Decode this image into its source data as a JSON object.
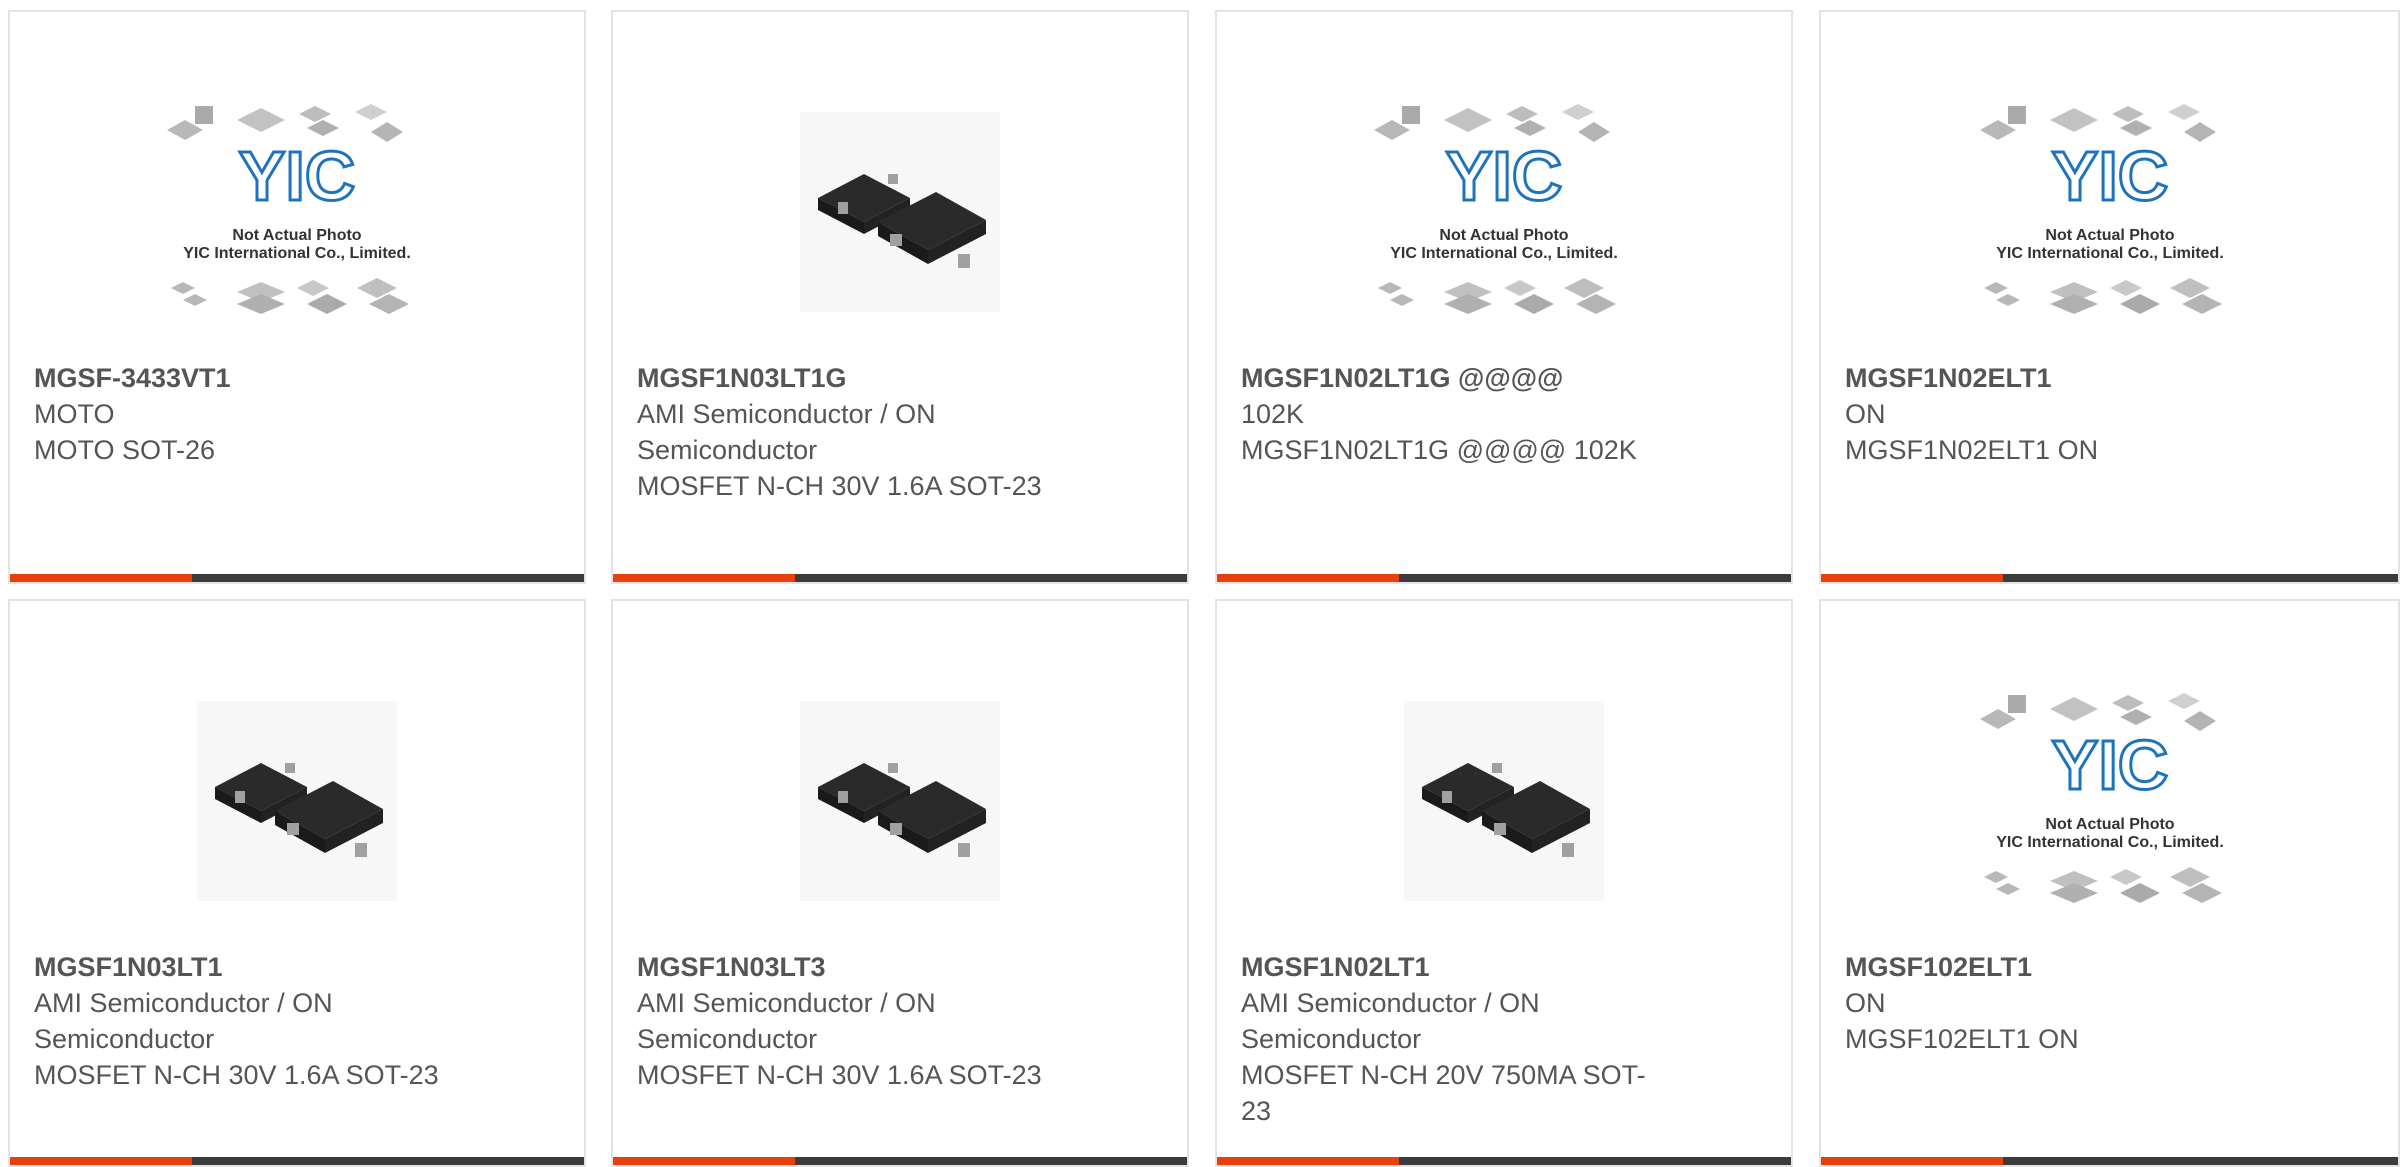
{
  "cards": [
    {
      "part": "MGSF-3433VT1",
      "manufacturer": "MOTO",
      "description": "MOTO SOT-26",
      "image": "placeholder",
      "placeholder_line1": "Not Actual Photo",
      "placeholder_line2": "YIC International Co., Limited.",
      "logo": "YIC"
    },
    {
      "part": "MGSF1N03LT1G",
      "manufacturer": "AMI Semiconductor / ON Semiconductor",
      "description": "MOSFET N-CH 30V 1.6A SOT-23",
      "image": "photo"
    },
    {
      "part": "MGSF1N02LT1G @@@@",
      "manufacturer": "102K",
      "description": "MGSF1N02LT1G @@@@ 102K",
      "image": "placeholder",
      "placeholder_line1": "Not Actual Photo",
      "placeholder_line2": "YIC International Co., Limited.",
      "logo": "YIC"
    },
    {
      "part": "MGSF1N02ELT1",
      "manufacturer": "ON",
      "description": "MGSF1N02ELT1 ON",
      "image": "placeholder",
      "placeholder_line1": "Not Actual Photo",
      "placeholder_line2": "YIC International Co., Limited.",
      "logo": "YIC"
    },
    {
      "part": "MGSF1N03LT1",
      "manufacturer": "AMI Semiconductor / ON Semiconductor",
      "description": "MOSFET N-CH 30V 1.6A SOT-23",
      "image": "photo"
    },
    {
      "part": "MGSF1N03LT3",
      "manufacturer": "AMI Semiconductor / ON Semiconductor",
      "description": "MOSFET N-CH 30V 1.6A SOT-23",
      "image": "photo"
    },
    {
      "part": "MGSF1N02LT1",
      "manufacturer": "AMI Semiconductor / ON Semiconductor",
      "description": "MOSFET N-CH 20V 750MA SOT-23",
      "image": "photo"
    },
    {
      "part": "MGSF102ELT1",
      "manufacturer": "ON",
      "description": "MGSF102ELT1 ON",
      "image": "placeholder",
      "placeholder_line1": "Not Actual Photo",
      "placeholder_line2": "YIC International Co., Limited.",
      "logo": "YIC"
    }
  ],
  "colors": {
    "accent": "#e8400c",
    "bar": "#3b3b3b",
    "text": "#555555",
    "border": "#e3e3e3",
    "logo": "#1e73be"
  }
}
